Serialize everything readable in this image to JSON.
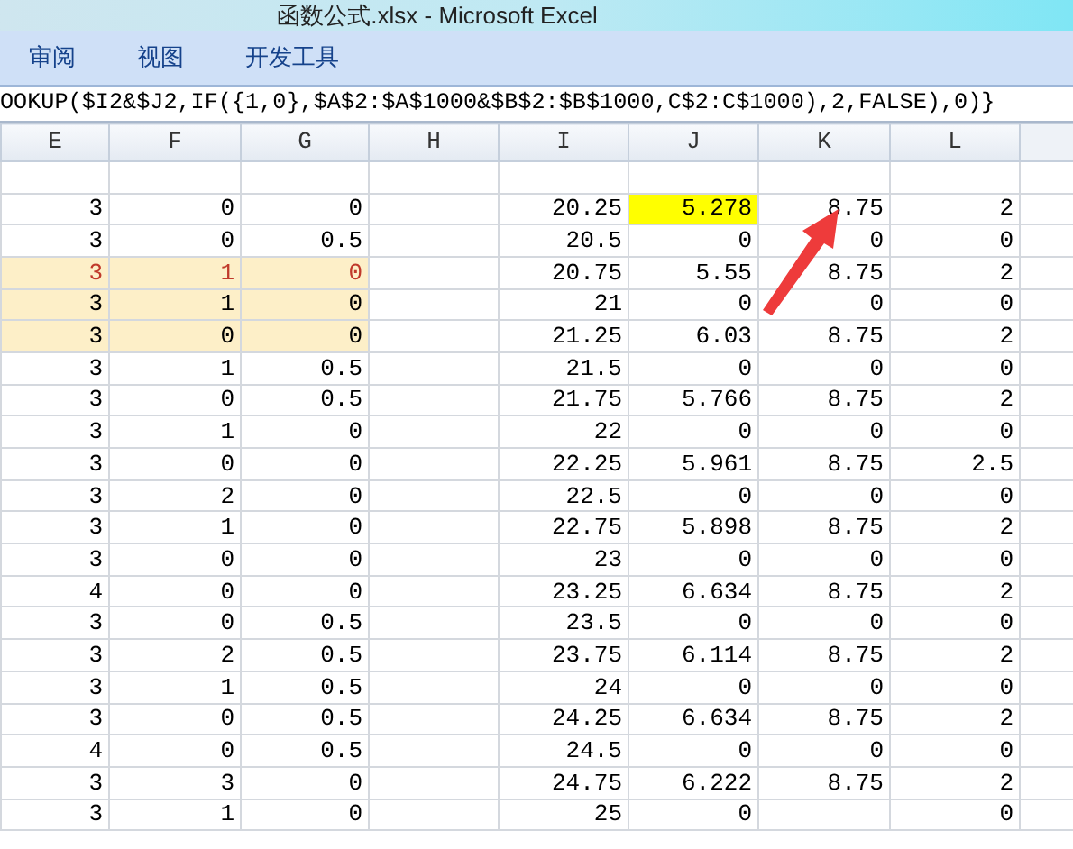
{
  "window": {
    "title": "函数公式.xlsx - Microsoft Excel"
  },
  "ribbon_tabs": [
    {
      "label": "审阅",
      "selected": false
    },
    {
      "label": "视图",
      "selected": false
    },
    {
      "label": "开发工具",
      "selected": false
    }
  ],
  "formula_bar": {
    "value": "OOKUP($I2&$J2,IF({1,0},$A$2:$A$1000&$B$2:$B$1000,C$2:C$1000),2,FALSE),0)}"
  },
  "columns": [
    "E",
    "F",
    "G",
    "H",
    "I",
    "J",
    "K",
    "L"
  ],
  "rows": [
    {
      "cells": [
        "3",
        "0",
        "0",
        null,
        "20.25",
        "5.278",
        "8.75",
        "2"
      ],
      "band": false,
      "emphasis": false,
      "flagged": true
    },
    {
      "cells": [
        "3",
        "0",
        "0.5",
        null,
        "20.5",
        "0",
        "0",
        "0"
      ],
      "band": false,
      "emphasis": false,
      "flagged": false
    },
    {
      "cells": [
        "3",
        "1",
        "0",
        null,
        "20.75",
        "5.55",
        "8.75",
        "2"
      ],
      "band": true,
      "emphasis": true,
      "flagged": false
    },
    {
      "cells": [
        "3",
        "1",
        "0",
        null,
        "21",
        "0",
        "0",
        "0"
      ],
      "band": true,
      "emphasis": false,
      "flagged": false
    },
    {
      "cells": [
        "3",
        "0",
        "0",
        null,
        "21.25",
        "6.03",
        "8.75",
        "2"
      ],
      "band": true,
      "emphasis": false,
      "flagged": false
    },
    {
      "cells": [
        "3",
        "1",
        "0.5",
        null,
        "21.5",
        "0",
        "0",
        "0"
      ],
      "band": false,
      "emphasis": false,
      "flagged": false
    },
    {
      "cells": [
        "3",
        "0",
        "0.5",
        null,
        "21.75",
        "5.766",
        "8.75",
        "2"
      ],
      "band": false,
      "emphasis": false,
      "flagged": false
    },
    {
      "cells": [
        "3",
        "1",
        "0",
        null,
        "22",
        "0",
        "0",
        "0"
      ],
      "band": false,
      "emphasis": false,
      "flagged": false
    },
    {
      "cells": [
        "3",
        "0",
        "0",
        null,
        "22.25",
        "5.961",
        "8.75",
        "2.5"
      ],
      "band": false,
      "emphasis": false,
      "flagged": false
    },
    {
      "cells": [
        "3",
        "2",
        "0",
        null,
        "22.5",
        "0",
        "0",
        "0"
      ],
      "band": false,
      "emphasis": false,
      "flagged": false
    },
    {
      "cells": [
        "3",
        "1",
        "0",
        null,
        "22.75",
        "5.898",
        "8.75",
        "2"
      ],
      "band": false,
      "emphasis": false,
      "flagged": false
    },
    {
      "cells": [
        "3",
        "0",
        "0",
        null,
        "23",
        "0",
        "0",
        "0"
      ],
      "band": false,
      "emphasis": false,
      "flagged": false
    },
    {
      "cells": [
        "4",
        "0",
        "0",
        null,
        "23.25",
        "6.634",
        "8.75",
        "2"
      ],
      "band": false,
      "emphasis": false,
      "flagged": false
    },
    {
      "cells": [
        "3",
        "0",
        "0.5",
        null,
        "23.5",
        "0",
        "0",
        "0"
      ],
      "band": false,
      "emphasis": false,
      "flagged": false
    },
    {
      "cells": [
        "3",
        "2",
        "0.5",
        null,
        "23.75",
        "6.114",
        "8.75",
        "2"
      ],
      "band": false,
      "emphasis": false,
      "flagged": false
    },
    {
      "cells": [
        "3",
        "1",
        "0.5",
        null,
        "24",
        "0",
        "0",
        "0"
      ],
      "band": false,
      "emphasis": false,
      "flagged": false
    },
    {
      "cells": [
        "3",
        "0",
        "0.5",
        null,
        "24.25",
        "6.634",
        "8.75",
        "2"
      ],
      "band": false,
      "emphasis": false,
      "flagged": false
    },
    {
      "cells": [
        "4",
        "0",
        "0.5",
        null,
        "24.5",
        "0",
        "0",
        "0"
      ],
      "band": false,
      "emphasis": false,
      "flagged": false
    },
    {
      "cells": [
        "3",
        "3",
        "0",
        null,
        "24.75",
        "6.222",
        "8.75",
        "2"
      ],
      "band": false,
      "emphasis": false,
      "flagged": false
    },
    {
      "cells": [
        "3",
        "1",
        "0",
        null,
        "25",
        "0",
        null,
        "0"
      ],
      "band": false,
      "emphasis": false,
      "flagged": false
    }
  ]
}
